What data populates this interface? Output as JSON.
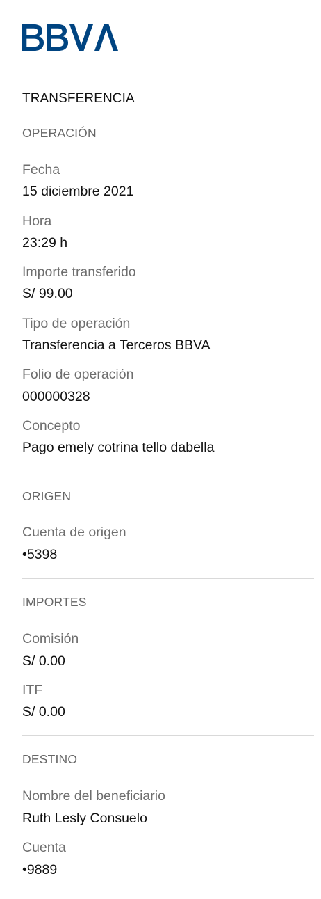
{
  "brand": {
    "logo_text": "BBVA",
    "color": "#004481"
  },
  "receipt_title": "TRANSFERENCIA",
  "operation": {
    "heading": "OPERACIÓN",
    "date_label": "Fecha",
    "date_value": "15 diciembre 2021",
    "time_label": "Hora",
    "time_value": "23:29 h",
    "amount_label": "Importe transferido",
    "amount_value": "S/ 99.00",
    "type_label": "Tipo de operación",
    "type_value": "Transferencia a Terceros BBVA",
    "folio_label": "Folio de operación",
    "folio_value": "000000328",
    "concept_label": "Concepto",
    "concept_value": "Pago emely cotrina tello dabella"
  },
  "origin": {
    "heading": "ORIGEN",
    "account_label": "Cuenta de origen",
    "account_value": "•5398"
  },
  "amounts": {
    "heading": "IMPORTES",
    "commission_label": "Comisión",
    "commission_value": "S/ 0.00",
    "itf_label": "ITF",
    "itf_value": "S/ 0.00"
  },
  "destination": {
    "heading": "DESTINO",
    "beneficiary_label": "Nombre del beneficiario",
    "beneficiary_value": "Ruth Lesly Consuelo",
    "account_label": "Cuenta",
    "account_value": "•9889"
  }
}
